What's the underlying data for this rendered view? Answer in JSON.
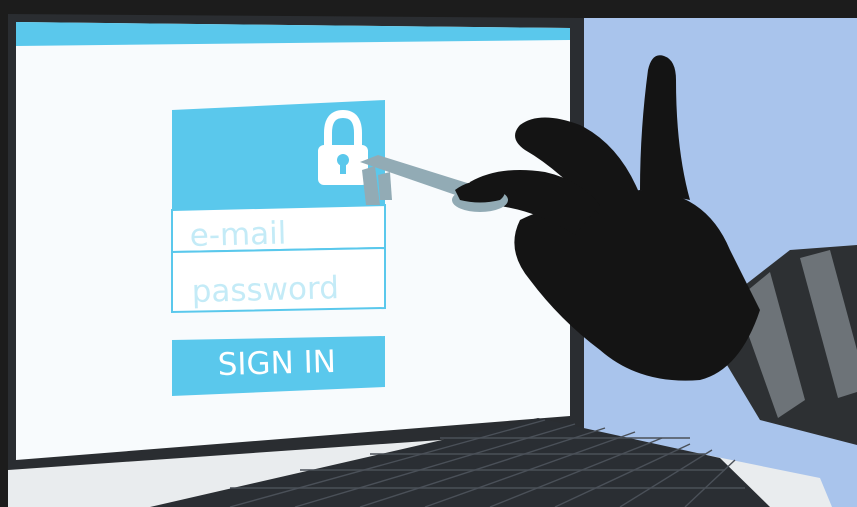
{
  "login_form": {
    "email_placeholder": "e-mail",
    "password_placeholder": "password",
    "sign_in_label": "SIGN IN"
  },
  "icons": {
    "lock": "lock-icon",
    "key": "key-icon"
  },
  "colors": {
    "background_dark": "#1c1c1c",
    "wall": "#a9c4ec",
    "screen": "#f8fbfd",
    "accent": "#5ac8ec",
    "accent_light": "#c4ebf7",
    "key": "#92abb5",
    "glove": "#141414",
    "sleeve_dark": "#2d3033",
    "sleeve_light": "#6d7378",
    "keyboard": "#2a2e33",
    "laptop_body": "#e9ecee"
  }
}
